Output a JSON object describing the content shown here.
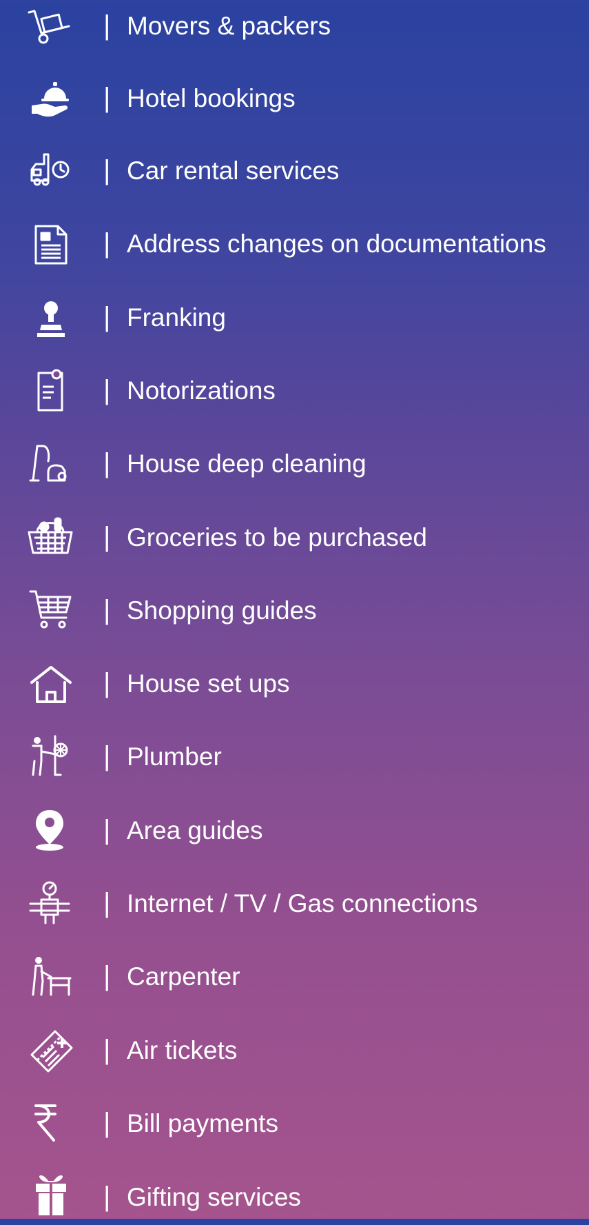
{
  "separator": "|",
  "colors": {
    "gradient_top": "#2b42a0",
    "gradient_bottom": "#a5548d",
    "text": "#ffffff"
  },
  "services": [
    {
      "label": "Movers & packers",
      "icon": "hand-truck-icon"
    },
    {
      "label": "Hotel bookings",
      "icon": "serving-hand-icon"
    },
    {
      "label": "Car rental services",
      "icon": "car-clock-icon"
    },
    {
      "label": "Address changes on documentations",
      "icon": "document-icon"
    },
    {
      "label": "Franking",
      "icon": "stamp-icon"
    },
    {
      "label": "Notorizations",
      "icon": "certificate-icon"
    },
    {
      "label": "House deep cleaning",
      "icon": "vacuum-cleaner-icon"
    },
    {
      "label": "Groceries to be purchased",
      "icon": "grocery-basket-icon"
    },
    {
      "label": "Shopping guides",
      "icon": "shopping-cart-icon"
    },
    {
      "label": "House set ups",
      "icon": "house-icon"
    },
    {
      "label": "Plumber",
      "icon": "plumber-icon"
    },
    {
      "label": "Area guides",
      "icon": "map-pin-icon"
    },
    {
      "label": "Internet / TV / Gas connections",
      "icon": "gas-meter-icon"
    },
    {
      "label": "Carpenter",
      "icon": "carpenter-icon"
    },
    {
      "label": "Air tickets",
      "icon": "air-ticket-icon"
    },
    {
      "label": "Bill payments",
      "icon": "rupee-icon"
    },
    {
      "label": "Gifting services",
      "icon": "gift-icon"
    }
  ]
}
